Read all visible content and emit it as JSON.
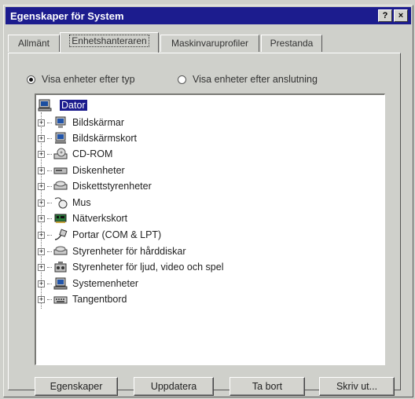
{
  "window": {
    "title": "Egenskaper för System",
    "help_button": "?",
    "close_button": "×"
  },
  "tabs": [
    {
      "label": "Allmänt",
      "active": false
    },
    {
      "label": "Enhetshanteraren",
      "active": true
    },
    {
      "label": "Maskinvaruprofiler",
      "active": false
    },
    {
      "label": "Prestanda",
      "active": false
    }
  ],
  "view_options": {
    "by_type": {
      "label": "Visa enheter efter typ",
      "selected": true
    },
    "by_connection": {
      "label": "Visa enheter efter anslutning",
      "selected": false
    }
  },
  "tree": {
    "root": {
      "label": "Dator",
      "icon": "computer-icon",
      "selected": true
    },
    "items": [
      {
        "label": "Bildskärmar",
        "icon": "monitor-icon"
      },
      {
        "label": "Bildskärmskort",
        "icon": "display-adapter-icon"
      },
      {
        "label": "CD-ROM",
        "icon": "cdrom-icon"
      },
      {
        "label": "Diskenheter",
        "icon": "disk-drive-icon"
      },
      {
        "label": "Diskettstyrenheter",
        "icon": "floppy-controller-icon"
      },
      {
        "label": "Mus",
        "icon": "mouse-icon"
      },
      {
        "label": "Nätverkskort",
        "icon": "network-card-icon"
      },
      {
        "label": "Portar (COM & LPT)",
        "icon": "port-icon"
      },
      {
        "label": "Styrenheter för hårddiskar",
        "icon": "hdd-controller-icon"
      },
      {
        "label": "Styrenheter för ljud, video och spel",
        "icon": "sound-icon"
      },
      {
        "label": "Systemenheter",
        "icon": "system-device-icon"
      },
      {
        "label": "Tangentbord",
        "icon": "keyboard-icon"
      }
    ]
  },
  "buttons": {
    "properties": "Egenskaper",
    "refresh": "Uppdatera",
    "remove": "Ta bort",
    "print": "Skriv ut..."
  }
}
